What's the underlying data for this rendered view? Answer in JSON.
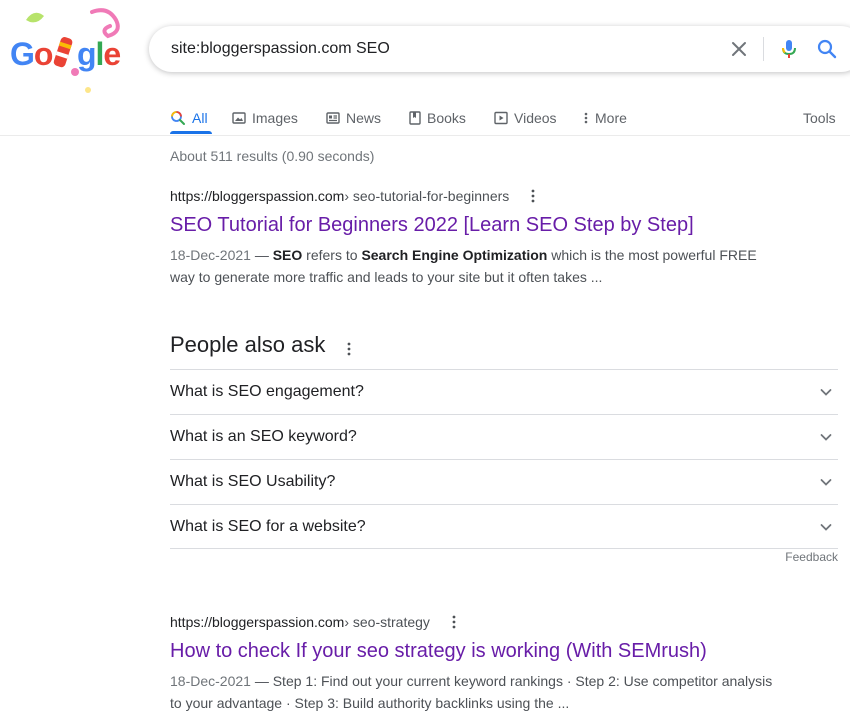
{
  "logo": {
    "text": "Google"
  },
  "search": {
    "query": "site:bloggerspassion.com SEO"
  },
  "tabs": [
    {
      "label": "All",
      "icon": "search-icon"
    },
    {
      "label": "Images",
      "icon": "image-icon"
    },
    {
      "label": "News",
      "icon": "news-icon"
    },
    {
      "label": "Books",
      "icon": "book-icon"
    },
    {
      "label": "Videos",
      "icon": "video-icon"
    },
    {
      "label": "More",
      "icon": "more-vert-icon"
    }
  ],
  "tools_label": "Tools",
  "stats": "About 511 results (0.90 seconds)",
  "results": [
    {
      "site": "https://bloggerspassion.com",
      "path": " › seo-tutorial-for-beginners",
      "title": "SEO Tutorial for Beginners 2022 [Learn SEO Step by Step]",
      "date": "18-Dec-2021",
      "snippet_parts": [
        "SEO",
        " refers to ",
        "Search Engine Optimization",
        " which is the most powerful FREE way to generate more traffic and leads to your site but it often takes ..."
      ]
    },
    {
      "site": "https://bloggerspassion.com",
      "path": " › seo-strategy",
      "title": "How to check If your seo strategy is working (With SEMrush)",
      "date": "18-Dec-2021",
      "snippet": "Step 1: Find out your current keyword rankings · Step 2: Use competitor analysis to your advantage · Step 3: Build authority backlinks using the ..."
    }
  ],
  "paa": {
    "title": "People also ask",
    "questions": [
      "What is SEO engagement?",
      "What is an SEO keyword?",
      "What is SEO Usability?",
      "What is SEO for a website?"
    ]
  },
  "feedback_label": "Feedback",
  "date_separator": " — ",
  "colors": {
    "link_visited": "#681da8",
    "accent": "#1a73e8"
  }
}
